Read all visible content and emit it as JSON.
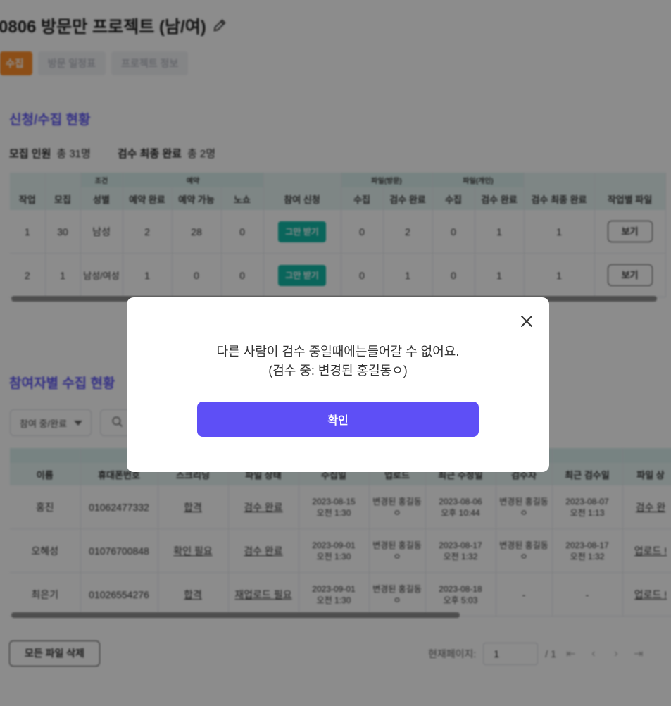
{
  "project": {
    "title": "0806 방문만 프로젝트 (남/여)",
    "edit_icon": "pencil-icon"
  },
  "tabs": [
    "수집",
    "방문 일정표",
    "프로젝트 정보"
  ],
  "recruit": {
    "section_title": "신청/수집 현황",
    "summary": {
      "recruit_label": "모집 인원",
      "recruit_value": "총 31명",
      "final_label": "검수 최종 완료",
      "final_value": "총 2명"
    },
    "group_headers": {
      "condition": "조건",
      "reservation": "예약",
      "file_visit": "파일(방문)",
      "file_personal": "파일(개인)"
    },
    "columns": [
      "작업",
      "모집",
      "성별",
      "예약 완료",
      "예약 가능",
      "노쇼",
      "참여 신청",
      "수집",
      "검수 완료",
      "수집",
      "검수 완료",
      "검수 최종 완료",
      "작업별 파일"
    ],
    "rows": [
      {
        "task": "1",
        "recruit": "30",
        "gender": "남성",
        "res_done": "2",
        "res_avail": "28",
        "noshow": "0",
        "apply": "그만 받기",
        "fv_collect": "0",
        "fv_review": "2",
        "fp_collect": "0",
        "fp_review": "1",
        "final": "1",
        "file": "보기"
      },
      {
        "task": "2",
        "recruit": "1",
        "gender": "남성/여성",
        "res_done": "1",
        "res_avail": "0",
        "noshow": "0",
        "apply": "그만 받기",
        "fv_collect": "0",
        "fv_review": "1",
        "fp_collect": "0",
        "fp_review": "1",
        "final": "1",
        "file": "보기"
      }
    ]
  },
  "participants": {
    "section_title": "참여자별 수집 현황",
    "filter_value": "참여 중/완료",
    "columns": [
      "이름",
      "휴대폰번호",
      "스크리닝",
      "파일 상태",
      "수집일",
      "업로드",
      "최근 수정일",
      "검수자",
      "최근 검수일",
      "파일 상"
    ],
    "rows": [
      {
        "name": "홍진",
        "phone": "01062477332",
        "screening": "합격",
        "file_status": "검수 완료",
        "collect_date": "2023-08-15",
        "collect_time": "오전 1:30",
        "uploader": "변경된 홍길동ㅇ",
        "modified_date": "2023-08-06",
        "modified_time": "오후 10:44",
        "reviewer": "변경된 홍길동ㅇ",
        "review_date": "2023-08-07",
        "review_time": "오전 1:13",
        "file_state": "검수 완"
      },
      {
        "name": "오혜성",
        "phone": "01076700848",
        "screening": "확인 필요",
        "file_status": "검수 완료",
        "collect_date": "2023-09-01",
        "collect_time": "오전 1:30",
        "uploader": "변경된 홍길동ㅇ",
        "modified_date": "2023-08-17",
        "modified_time": "오전 1:32",
        "reviewer": "변경된 홍길동ㅇ",
        "review_date": "2023-08-17",
        "review_time": "오전 1:32",
        "file_state": "업로드 !"
      },
      {
        "name": "최은기",
        "phone": "01026554276",
        "screening": "합격",
        "file_status": "재업로드 필요",
        "collect_date": "2023-09-01",
        "collect_time": "오전 1:30",
        "uploader": "변경된 홍길동ㅇ",
        "modified_date": "2023-08-18",
        "modified_time": "오후 5:03",
        "reviewer": "-",
        "review_date": "-",
        "review_time": "",
        "file_state": "업로드 !"
      }
    ]
  },
  "footer": {
    "delete_all": "모든 파일 삭제",
    "page_label": "현재페이지:",
    "page_value": "1",
    "page_total": "/ 1"
  },
  "modal": {
    "line1": "다른 사람이 검수 중일때에는들어갈 수 없어요.",
    "line2": "(검수 중: 변경된 홍길동ㅇ)",
    "confirm": "확인"
  },
  "colors": {
    "accent": "#5e4ff6",
    "orange": "#ff8f2a",
    "teal": "#13b8a6",
    "section": "#5b54f2"
  }
}
